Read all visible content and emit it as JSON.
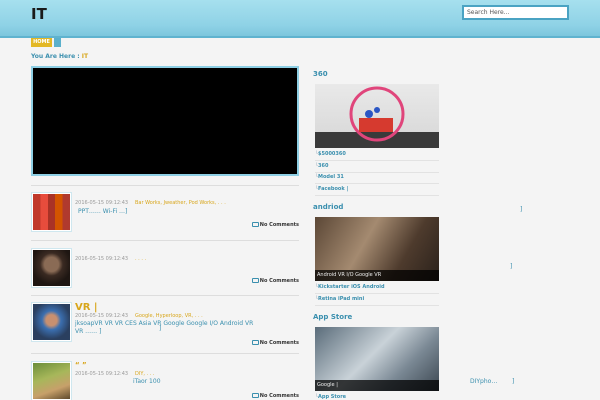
{
  "header": {
    "site_title": "IT",
    "search_placeholder": "Search Here..."
  },
  "nav": {
    "home_label": "HOME"
  },
  "breadcrumb": {
    "prefix": "You Are Here :",
    "current": "IT"
  },
  "posts": [
    {
      "title": "",
      "date": "2016-05-15 09:12:43",
      "tags": "Bar Works, Jweather, Pod Works, . . .",
      "excerpt": "PPT……  Wi-Fi  …]",
      "comments_label": "No Comments"
    },
    {
      "title": "",
      "date": "2016-05-15 09:12:43",
      "tags": ". . . .",
      "excerpt": "",
      "comments_label": "No Comments"
    },
    {
      "title": "VR |",
      "date": "2016-05-15 09:12:43",
      "tags": "Google, Hyperloop, VR, . . .",
      "excerpt": "jksoapVR   VR   VR CES Asia   VR Google   Google I/O   Android VR   VR ……  ]",
      "comments_label": "No Comments"
    },
    {
      "title": "“ ”",
      "date": "2016-05-15 09:12:43",
      "tags": "DIY, . . .",
      "excerpt": "iTaor   100",
      "comments_label": "No Comments"
    }
  ],
  "sidebar": {
    "sections": [
      {
        "heading": "360",
        "caption": "",
        "items": [
          "$5000360",
          "360",
          "Model 31",
          "Facebook |"
        ]
      },
      {
        "heading": "andriod",
        "caption": "Android VR   I/O   Google   VR",
        "items": [
          "Kickstarter   iOS   Android",
          "Retina   iPad mini"
        ]
      },
      {
        "heading": "App Store",
        "caption": "Google   |",
        "items": [
          "App Store"
        ]
      }
    ]
  },
  "stray_text": {
    "s1": "]",
    "s2": "]",
    "s3": "]",
    "s4": "DIYpho…",
    "s5": "]"
  },
  "colors": {
    "accent": "#3a8fae",
    "gold": "#d8a61b",
    "header": "#8fd2e6"
  }
}
